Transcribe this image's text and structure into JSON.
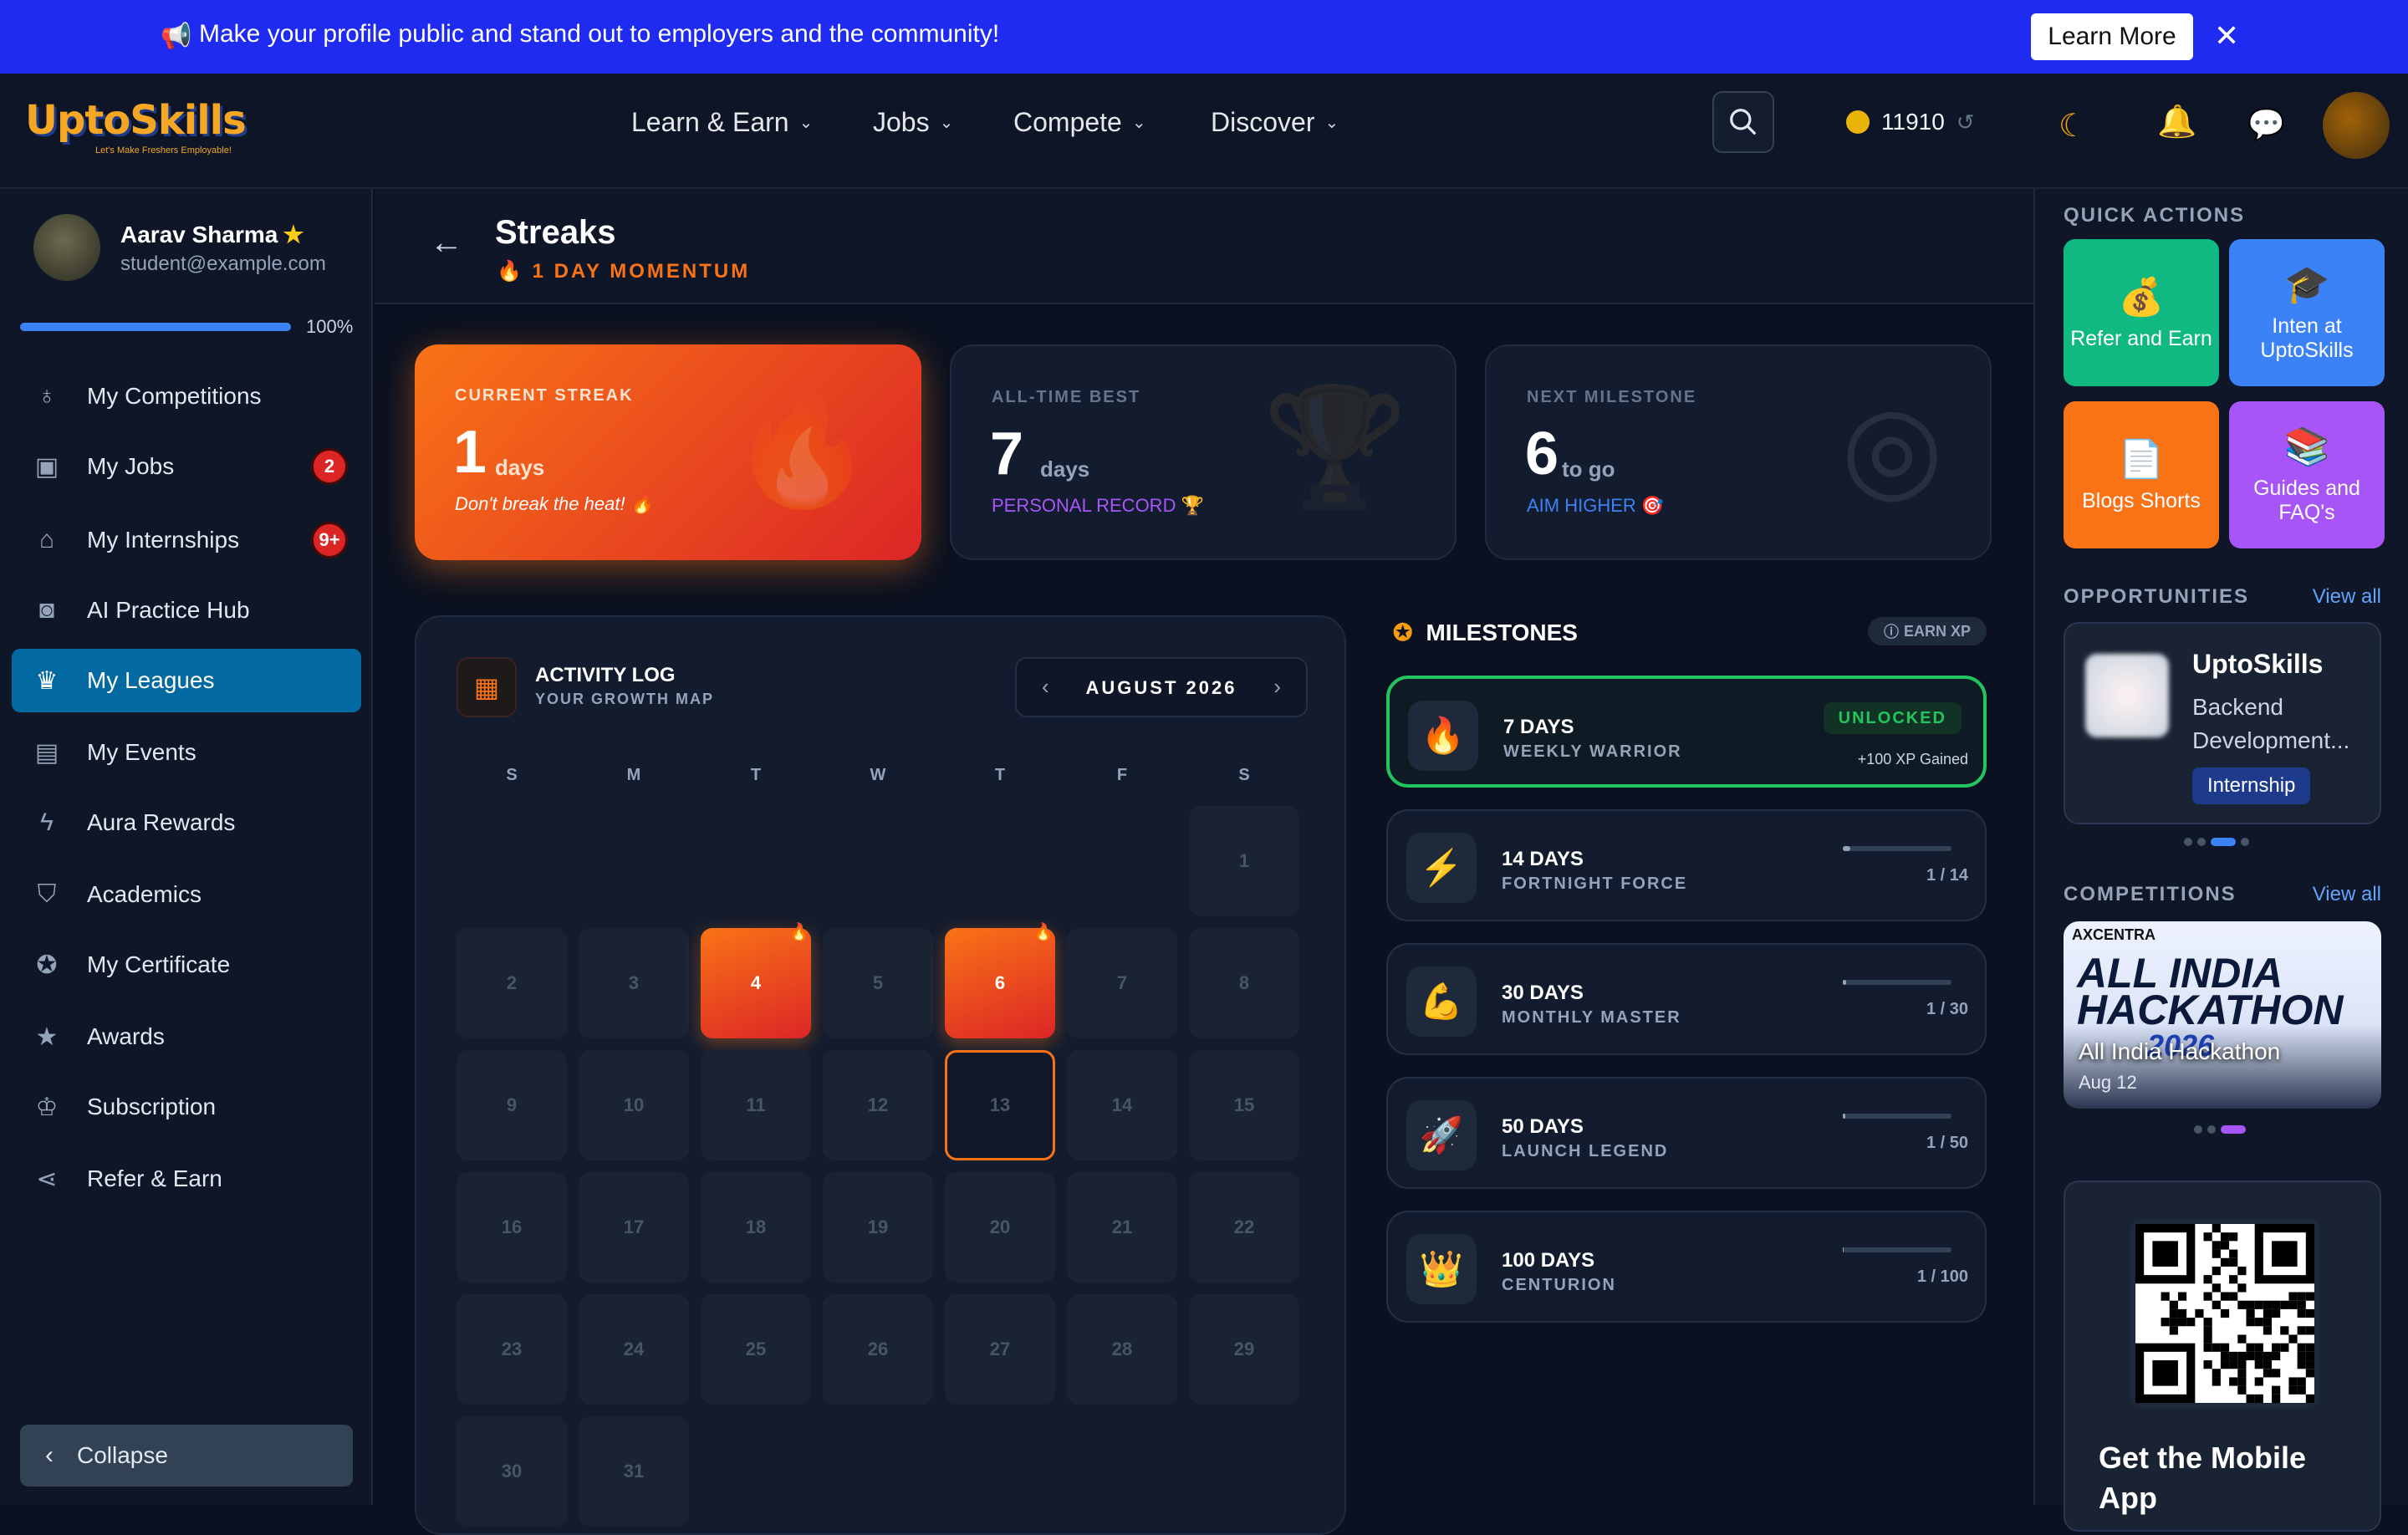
{
  "banner": {
    "message": "Make your profile public and stand out to employers and the community!",
    "learn_more": "Learn More",
    "close": "✕",
    "megaphone": "📢"
  },
  "logo": {
    "text": "UptoSkills",
    "tagline": "Let's Make Freshers Employable!"
  },
  "nav": {
    "items": [
      "Learn & Earn",
      "Jobs",
      "Compete",
      "Discover"
    ]
  },
  "header": {
    "coins": "11910"
  },
  "profile": {
    "name": "Aarav Sharma",
    "email": "student@example.com",
    "progress": 100,
    "progress_label": "100%"
  },
  "sidebar": {
    "items": [
      {
        "label": "My Competitions",
        "icon": "medal-icon",
        "glyph": "♁"
      },
      {
        "label": "My Jobs",
        "icon": "briefcase-icon",
        "glyph": "▣",
        "badge": "2"
      },
      {
        "label": "My Internships",
        "icon": "building-icon",
        "glyph": "⌂",
        "badge": "9+"
      },
      {
        "label": "AI Practice Hub",
        "icon": "robot-icon",
        "glyph": "◙"
      },
      {
        "label": "My Leagues",
        "icon": "trophy-icon",
        "glyph": "♛",
        "active": true
      },
      {
        "label": "My Events",
        "icon": "book-icon",
        "glyph": "▤"
      },
      {
        "label": "Aura Rewards",
        "icon": "bolt-icon",
        "glyph": "ϟ"
      },
      {
        "label": "Academics",
        "icon": "graduation-cap-icon",
        "glyph": "⛉"
      },
      {
        "label": "My Certificate",
        "icon": "certificate-icon",
        "glyph": "✪"
      },
      {
        "label": "Awards",
        "icon": "star-icon",
        "glyph": "★"
      },
      {
        "label": "Subscription",
        "icon": "crown-icon",
        "glyph": "♔"
      },
      {
        "label": "Refer & Earn",
        "icon": "share-icon",
        "glyph": "⋖"
      }
    ],
    "collapse": "Collapse"
  },
  "page": {
    "title": "Streaks",
    "subtitle": "🔥 1 DAY MOMENTUM"
  },
  "stats": {
    "current": {
      "label": "CURRENT STREAK",
      "value": "1",
      "unit": "days",
      "note": "Don't break the heat! 🔥"
    },
    "best": {
      "label": "ALL-TIME BEST",
      "value": "7",
      "unit": "days",
      "note": "PERSONAL RECORD 🏆"
    },
    "next": {
      "label": "NEXT MILESTONE",
      "value": "6",
      "unit": "to go",
      "note": "AIM HIGHER 🎯"
    }
  },
  "activity": {
    "title": "ACTIVITY LOG",
    "subtitle": "YOUR GROWTH MAP",
    "month": "AUGUST 2026",
    "weekdays": [
      "S",
      "M",
      "T",
      "W",
      "T",
      "F",
      "S"
    ],
    "first_weekday": 6,
    "days_in_month": 31,
    "streak_days": [
      4,
      6
    ],
    "today": 13
  },
  "milestones": {
    "title": "MILESTONES",
    "earn_xp": "EARN XP",
    "items": [
      {
        "days": "7 DAYS",
        "name": "WEEKLY WARRIOR",
        "icon": "fire-icon",
        "emoji": "🔥",
        "unlocked": true,
        "status": "UNLOCKED",
        "xp": "+100 XP Gained"
      },
      {
        "days": "14 DAYS",
        "name": "FORTNIGHT FORCE",
        "icon": "bolt-icon",
        "emoji": "⚡",
        "progress": "1 / 14",
        "fraction": 0.07
      },
      {
        "days": "30 DAYS",
        "name": "MONTHLY MASTER",
        "icon": "muscle-icon",
        "emoji": "💪",
        "progress": "1 / 30",
        "fraction": 0.03
      },
      {
        "days": "50 DAYS",
        "name": "LAUNCH LEGEND",
        "icon": "rocket-icon",
        "emoji": "🚀",
        "progress": "1 / 50",
        "fraction": 0.02
      },
      {
        "days": "100 DAYS",
        "name": "CENTURION",
        "icon": "crown-icon",
        "emoji": "👑",
        "progress": "1 / 100",
        "fraction": 0.01
      }
    ]
  },
  "right": {
    "quick_actions_title": "QUICK ACTIONS",
    "quick_actions": [
      {
        "label": "Refer and Earn",
        "icon": "money-bag-icon",
        "emoji": "💰",
        "color": "#10b981"
      },
      {
        "label": "Inten at UptoSkills",
        "icon": "graduation-cap-icon",
        "emoji": "🎓",
        "color": "#3b82f6"
      },
      {
        "label": "Blogs Shorts",
        "icon": "document-icon",
        "emoji": "📄",
        "color": "#f97316"
      },
      {
        "label": "Guides and FAQ's",
        "icon": "books-icon",
        "emoji": "📚",
        "color": "#a855f7"
      }
    ],
    "opportunities_title": "OPPORTUNITIES",
    "view_all": "View all",
    "opportunity": {
      "company": "UptoSkills",
      "role": "Backend Development...",
      "tag": "Internship"
    },
    "competitions_title": "COMPETITIONS",
    "competition": {
      "brand": "AXCENTRA",
      "banner_line1": "ALL INDIA",
      "banner_line2": "HACKATHON",
      "banner_year": "2026",
      "title": "All India Hackathon",
      "date": "Aug 12"
    },
    "mobile_title": "Get the Mobile App"
  }
}
